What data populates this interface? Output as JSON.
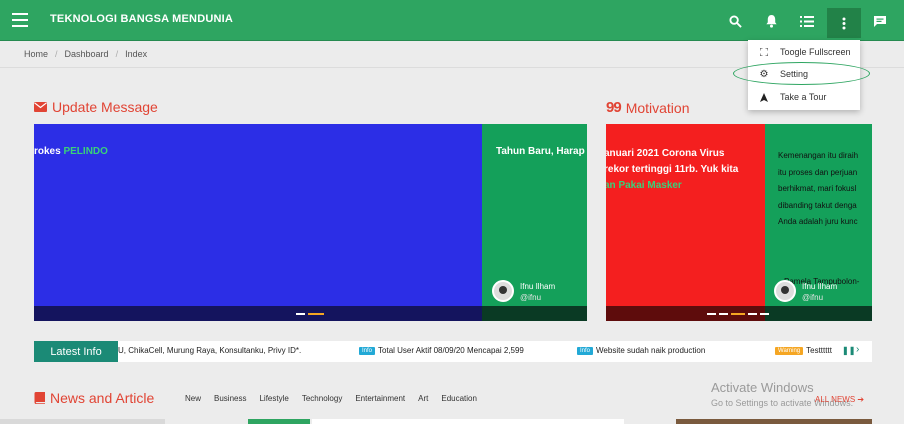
{
  "header": {
    "title": "TEKNOLOGI BANGSA MENDUNIA",
    "menu_icon": "hamburger-icon",
    "icons": [
      "search-icon",
      "bell-icon",
      "list-icon",
      "more-vertical-icon",
      "message-icon"
    ]
  },
  "dropdown": {
    "items": [
      {
        "label": "Toogle Fullscreen",
        "icon": "fullscreen-icon"
      },
      {
        "label": "Setting",
        "icon": "gear-icon"
      },
      {
        "label": "Take a Tour",
        "icon": "navigation-icon"
      }
    ]
  },
  "breadcrumb": [
    "Home",
    "Dashboard",
    "Index"
  ],
  "update_message": {
    "heading": "Update Message",
    "slide_left_text": "rokes ",
    "slide_left_highlight": "PELINDO",
    "slide_right_text": "Tahun Baru, Harap",
    "author_name": "Ifnu Ilham",
    "author_handle": "@ifnu"
  },
  "motivation": {
    "heading": "Motivation",
    "slide_left_lines": [
      "anuari 2021 Corona Virus",
      "rekor tertinggi 11rb. Yuk kita"
    ],
    "slide_left_highlight": "an Pakai Masker",
    "slide_right_lines": [
      "Kemenangan itu diraih",
      "itu proses dan perjuan",
      "berhikmat, mari fokusl",
      "dibanding takut denga",
      "Anda adalah juru kunc"
    ],
    "slide_right_footer": "Pamela Tampubolon-",
    "author_name": "Ifnu Ilham",
    "author_handle": "@ifnu"
  },
  "latest_info": {
    "label": "Latest Info",
    "items": [
      {
        "tag": "",
        "text": "U, ChikaCell, Murung Raya, Konsultanku, Privy ID*."
      },
      {
        "tag": "Info",
        "text": "Total User Aktif 08/09/20 Mencapai 2,599"
      },
      {
        "tag": "Info",
        "text": "Website sudah naik production"
      },
      {
        "tag": "Warning",
        "text": "Testttttt"
      }
    ]
  },
  "news": {
    "heading": "News and Article",
    "tabs": [
      "New",
      "Business",
      "Lifestyle",
      "Technology",
      "Entertainment",
      "Art",
      "Education"
    ],
    "all_news": "ALL NEWS"
  },
  "watermark": {
    "line1": "Activate Windows",
    "line2": "Go to Settings to activate Windows."
  },
  "colors": {
    "brand_green": "#2ea561",
    "accent_red": "#e14434",
    "slide_blue": "#2c2ee6",
    "slide_green": "#14a05a",
    "slide_red": "#f41f1f",
    "info_teal": "#1b8a76",
    "tag_info": "#22a9d6",
    "tag_warning": "#f5a623"
  }
}
